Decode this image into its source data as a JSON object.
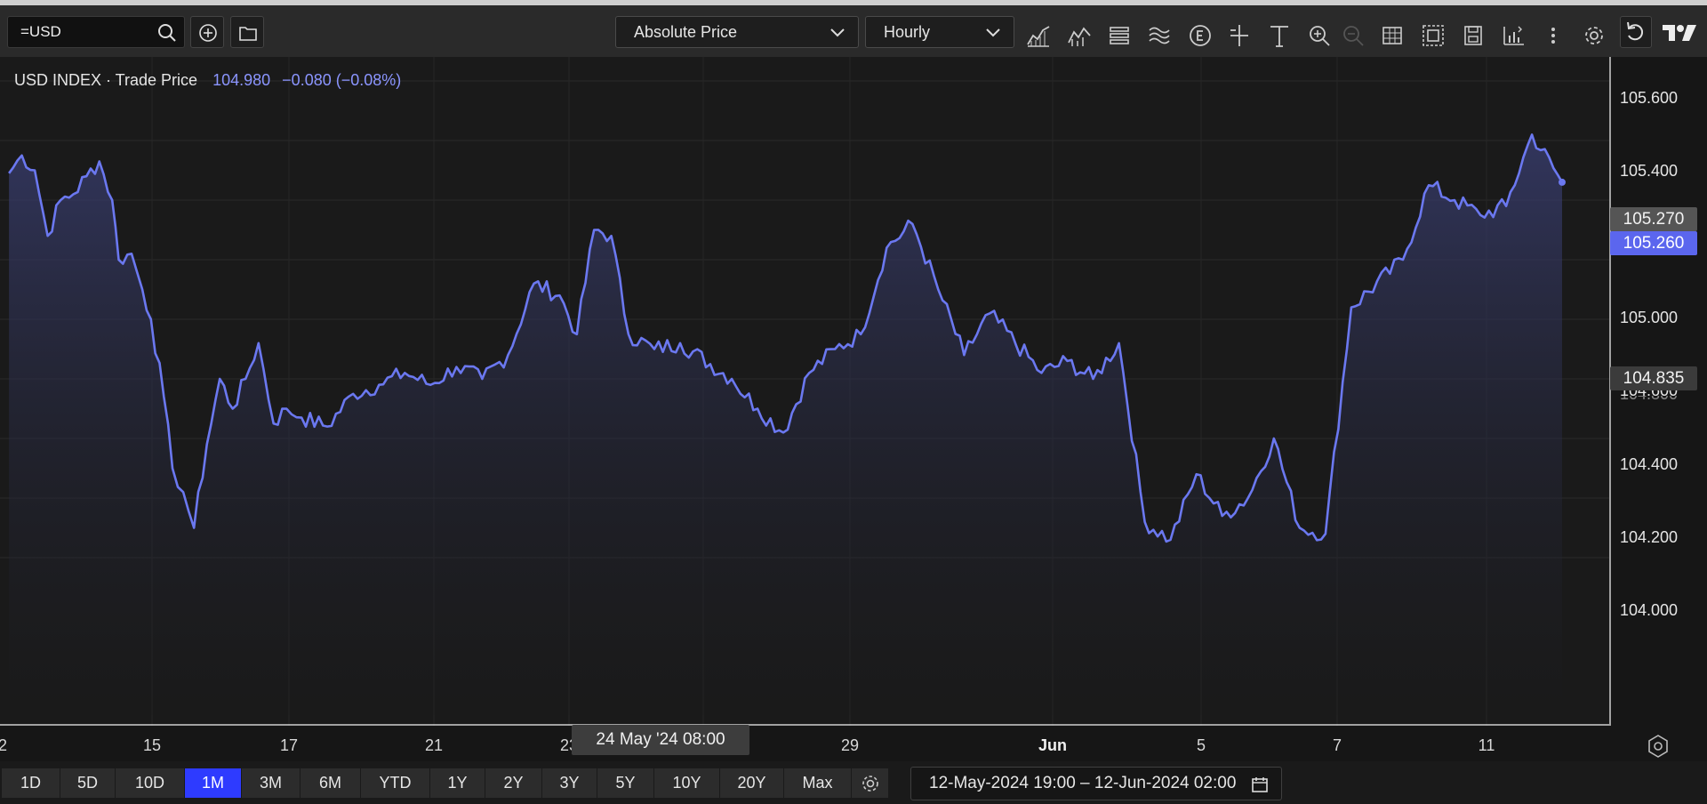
{
  "toolbar": {
    "symbol": "=USD",
    "price_mode": "Absolute Price",
    "interval": "Hourly",
    "icons": [
      "add-circle-icon",
      "folder-icon",
      "mountain-chart-icon",
      "indicator-icon",
      "list-icon",
      "wave-icon",
      "event-icon",
      "crosshair-icon",
      "text-icon",
      "zoom-in-icon",
      "zoom-out-icon",
      "table-icon",
      "layout-icon",
      "save-icon",
      "compare-chart-icon",
      "more-icon",
      "settings-icon",
      "undo-icon",
      "tradingview-logo"
    ]
  },
  "legend": {
    "name": "USD INDEX · Trade Price",
    "value": "104.980",
    "change": "−0.080 (−0.08%)"
  },
  "y_axis": {
    "labels": [
      "105.600",
      "105.400",
      "105.000",
      "104.600",
      "104.400",
      "104.200",
      "104.000"
    ],
    "hidden_label": "104.800",
    "tag_reference": "105.270",
    "tag_last": "105.260",
    "tag_cursor": "104.835"
  },
  "x_axis": {
    "labels": [
      "2",
      "15",
      "17",
      "21",
      "23",
      "29",
      "Jun",
      "5",
      "7",
      "11"
    ],
    "crosshair": "24 May '24   08:00"
  },
  "ranges": [
    "1D",
    "5D",
    "10D",
    "1M",
    "3M",
    "6M",
    "YTD",
    "1Y",
    "2Y",
    "3Y",
    "5Y",
    "10Y",
    "20Y",
    "Max"
  ],
  "active_range": "1M",
  "date_range": "12-May-2024 19:00  –  12-Jun-2024 02:00",
  "colors": {
    "line": "#6b78f0",
    "active": "#2e3bff",
    "background": "#1a1a1a"
  },
  "chart_data": {
    "type": "area",
    "title": "USD INDEX · Trade Price",
    "ylim": [
      103.9,
      105.75
    ],
    "x_range": [
      "12 May 2024 19:00",
      "12 Jun 2024 02:00"
    ],
    "grid": true,
    "series": [
      {
        "name": "USD INDEX · Trade Price",
        "points": [
          [
            "13 May",
            105.29
          ],
          [
            "13 May 06:00",
            105.35
          ],
          [
            "13 May 12:00",
            105.3
          ],
          [
            "13 May 18:00",
            105.08
          ],
          [
            "14 May",
            105.2
          ],
          [
            "14 May 06:00",
            105.22
          ],
          [
            "14 May 12:00",
            105.28
          ],
          [
            "14 May 18:00",
            105.33
          ],
          [
            "15 May",
            105.2
          ],
          [
            "15 May 03:00",
            105.0
          ],
          [
            "15 May 09:00",
            105.02
          ],
          [
            "15 May 14:00",
            104.9
          ],
          [
            "15 May 18:00",
            104.8
          ],
          [
            "16 May",
            104.54
          ],
          [
            "16 May 04:00",
            104.3
          ],
          [
            "16 May 09:00",
            104.22
          ],
          [
            "16 May 14:00",
            104.1
          ],
          [
            "16 May 20:00",
            104.38
          ],
          [
            "17 May 02:00",
            104.6
          ],
          [
            "17 May 08:00",
            104.5
          ],
          [
            "17 May 14:00",
            104.6
          ],
          [
            "17 May 20:00",
            104.72
          ],
          [
            "18 May 03:00",
            104.45
          ],
          [
            "18 May 09:00",
            104.5
          ],
          [
            "18 May 16:00",
            104.47
          ],
          [
            "19 May 04:00",
            104.44
          ],
          [
            "19 May 16:00",
            104.55
          ],
          [
            "20 May 04:00",
            104.58
          ],
          [
            "20 May 16:00",
            104.62
          ],
          [
            "21 May 04:00",
            104.58
          ],
          [
            "21 May 16:00",
            104.64
          ],
          [
            "22 May 04:00",
            104.6
          ],
          [
            "22 May 16:00",
            104.68
          ],
          [
            "23 May 04:00",
            104.92
          ],
          [
            "23 May 16:00",
            104.88
          ],
          [
            "24 May",
            104.75
          ],
          [
            "24 May 08:00",
            105.1
          ],
          [
            "24 May 16:00",
            105.08
          ],
          [
            "25 May",
            104.75
          ],
          [
            "25 May 12:00",
            104.7
          ],
          [
            "26 May",
            104.72
          ],
          [
            "27 May",
            104.6
          ],
          [
            "27 May 12:00",
            104.5
          ],
          [
            "28 May",
            104.42
          ],
          [
            "28 May 12:00",
            104.62
          ],
          [
            "29 May",
            104.7
          ],
          [
            "29 May 12:00",
            104.75
          ],
          [
            "30 May",
            105.04
          ],
          [
            "30 May 12:00",
            105.12
          ],
          [
            "31 May",
            104.9
          ],
          [
            "31 May 12:00",
            104.68
          ],
          [
            "1 Jun",
            104.82
          ],
          [
            "2 Jun",
            104.62
          ],
          [
            "2 Jun 12:00",
            104.66
          ],
          [
            "3 Jun",
            104.6
          ],
          [
            "3 Jun 12:00",
            104.72
          ],
          [
            "4 Jun",
            104.12
          ],
          [
            "4 Jun 12:00",
            104.06
          ],
          [
            "5 Jun",
            104.28
          ],
          [
            "5 Jun 12:00",
            104.14
          ],
          [
            "6 Jun",
            104.2
          ],
          [
            "6 Jun 12:00",
            104.4
          ],
          [
            "7 Jun",
            104.1
          ],
          [
            "7 Jun 12:00",
            104.08
          ],
          [
            "8 Jun",
            104.84
          ],
          [
            "9 Jun",
            105.0
          ],
          [
            "9 Jun 12:00",
            105.25
          ],
          [
            "10 Jun",
            105.2
          ],
          [
            "10 Jun 12:00",
            105.15
          ],
          [
            "11 Jun",
            105.18
          ],
          [
            "11 Jun 12:00",
            105.42
          ],
          [
            "12 Jun 02:00",
            105.26
          ]
        ]
      }
    ]
  }
}
